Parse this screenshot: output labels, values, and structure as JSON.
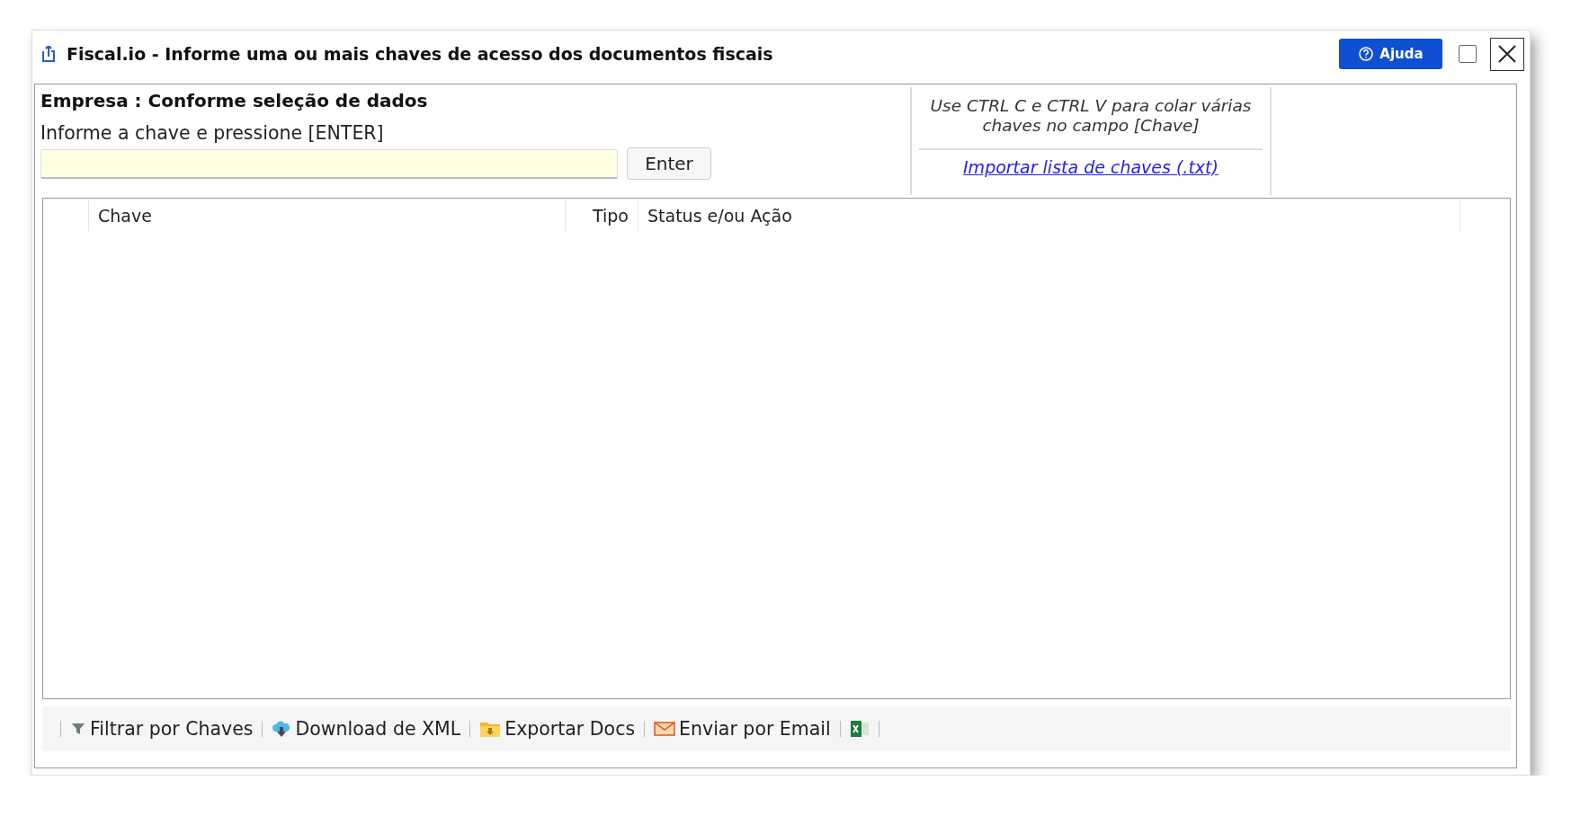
{
  "window": {
    "title": "Fiscal.io - Informe uma ou mais chaves de acesso dos documentos fiscais",
    "help_button": "Ajuda"
  },
  "form": {
    "company": "Empresa : Conforme seleção de dados",
    "prompt": "Informe a chave e pressione [ENTER]",
    "enter_button": "Enter"
  },
  "hint": {
    "text": "Use CTRL C e CTRL V para colar várias chaves no campo [Chave]",
    "link": "Importar lista de chaves (.txt)"
  },
  "table": {
    "columns": [
      "Chave",
      "Tipo",
      "Status e/ou Ação"
    ]
  },
  "toolbar": [
    {
      "kind": "filter",
      "label": "Filtrar por Chaves"
    },
    {
      "kind": "download",
      "label": "Download de XML"
    },
    {
      "kind": "export",
      "label": "Exportar Docs"
    },
    {
      "kind": "email",
      "label": "Enviar por Email"
    },
    {
      "kind": "excel"
    }
  ]
}
